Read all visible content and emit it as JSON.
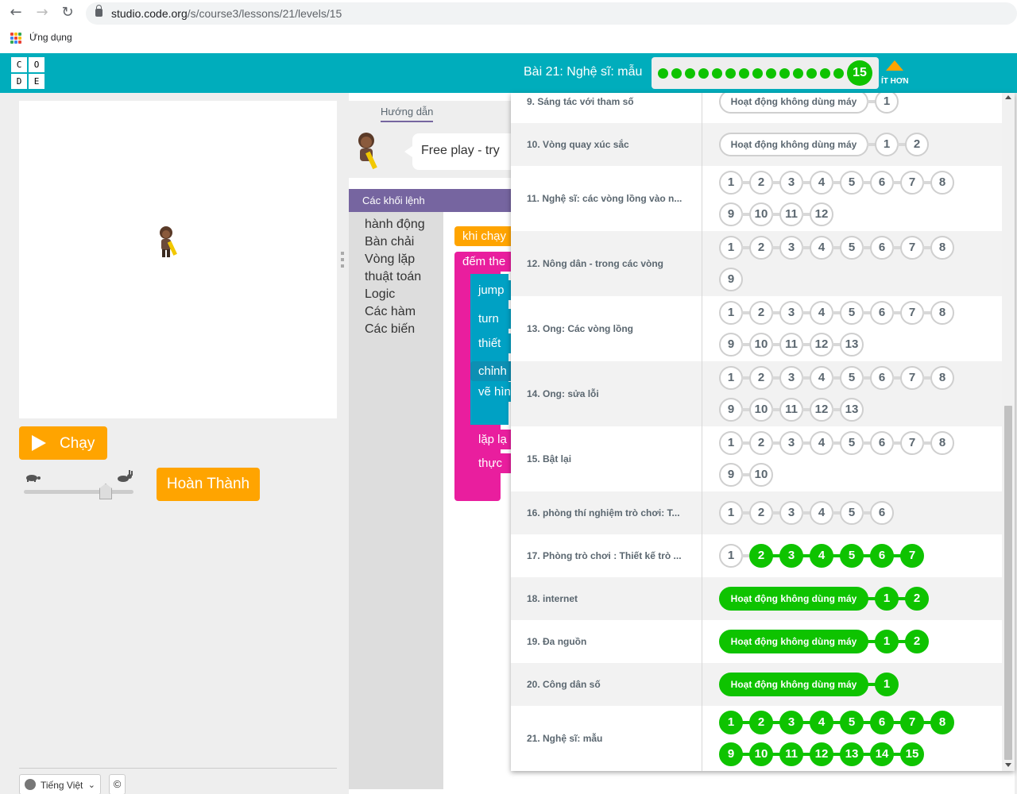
{
  "browser": {
    "url_host": "studio.code.org",
    "url_path": "/s/course3/lessons/21/levels/15",
    "bookmark_apps_label": "Ứng dụng",
    "icons": [
      "back-icon",
      "forward-icon",
      "reload-icon",
      "lock-icon",
      "apps-icon"
    ]
  },
  "header": {
    "logo_letters": [
      "C",
      "O",
      "D",
      "E"
    ],
    "lesson_title": "Bài 21: Nghệ sĩ: mẫu",
    "completed_dots": 14,
    "current_level": "15",
    "less_label": "ÍT HƠN",
    "colors": {
      "header_bg": "#00adbc",
      "done": "#0ec300",
      "accent": "#ffa400"
    }
  },
  "left": {
    "run_label": "Chạy",
    "finish_label": "Hoàn Thành",
    "language": "Tiếng Việt",
    "copyright_symbol": "©"
  },
  "instructions": {
    "tab_label": "Hướng dẫn",
    "text": "Free play - try"
  },
  "toolbox": {
    "title": "Các khối lệnh",
    "categories": [
      "hành động",
      "Bàn chải",
      "Vòng lặp",
      "thuật toán",
      "Logic",
      "Các hàm",
      "Các biến"
    ]
  },
  "workspace": {
    "blocks": [
      "khi chạy",
      "đếm the",
      "jump",
      "turn",
      "thiết",
      "chỉnh",
      "vẽ hìn",
      "lặp lạ",
      "thực"
    ]
  },
  "lessons": [
    {
      "name": "9. Sáng tác với tham số",
      "unplugged": "Hoạt động không dùng máy",
      "levels": [
        "1"
      ],
      "done": [],
      "unplugged_done": false
    },
    {
      "name": "10. Vòng quay xúc sắc",
      "unplugged": "Hoạt động không dùng máy",
      "levels": [
        "1",
        "2"
      ],
      "done": [],
      "unplugged_done": false
    },
    {
      "name": "11. Nghệ sĩ: các vòng lồng vào n...",
      "levels": [
        "1",
        "2",
        "3",
        "4",
        "5",
        "6",
        "7",
        "8",
        "9",
        "10",
        "11",
        "12"
      ],
      "done": []
    },
    {
      "name": "12. Nông dân - trong các vòng",
      "levels": [
        "1",
        "2",
        "3",
        "4",
        "5",
        "6",
        "7",
        "8",
        "9"
      ],
      "done": []
    },
    {
      "name": "13. Ong: Các vòng lồng",
      "levels": [
        "1",
        "2",
        "3",
        "4",
        "5",
        "6",
        "7",
        "8",
        "9",
        "10",
        "11",
        "12",
        "13"
      ],
      "done": []
    },
    {
      "name": "14. Ong: sửa lỗi",
      "levels": [
        "1",
        "2",
        "3",
        "4",
        "5",
        "6",
        "7",
        "8",
        "9",
        "10",
        "11",
        "12",
        "13"
      ],
      "done": []
    },
    {
      "name": "15. Bật lại",
      "levels": [
        "1",
        "2",
        "3",
        "4",
        "5",
        "6",
        "7",
        "8",
        "9",
        "10"
      ],
      "done": []
    },
    {
      "name": "16. phòng thí nghiệm trò chơi: T...",
      "levels": [
        "1",
        "2",
        "3",
        "4",
        "5",
        "6"
      ],
      "done": []
    },
    {
      "name": "17. Phòng trò chơi : Thiết kế trò ...",
      "levels": [
        "1",
        "2",
        "3",
        "4",
        "5",
        "6",
        "7"
      ],
      "done": [
        "2",
        "3",
        "4",
        "5",
        "6",
        "7"
      ]
    },
    {
      "name": "18. internet",
      "unplugged": "Hoạt động không dùng máy",
      "levels": [
        "1",
        "2"
      ],
      "done": [
        "1",
        "2"
      ],
      "unplugged_done": true
    },
    {
      "name": "19. Đa nguồn",
      "unplugged": "Hoạt động không dùng máy",
      "levels": [
        "1",
        "2"
      ],
      "done": [
        "1",
        "2"
      ],
      "unplugged_done": true
    },
    {
      "name": "20. Công dân số",
      "unplugged": "Hoạt động không dùng máy",
      "levels": [
        "1"
      ],
      "done": [
        "1"
      ],
      "unplugged_done": true
    },
    {
      "name": "21. Nghệ sĩ: mẫu",
      "levels": [
        "1",
        "2",
        "3",
        "4",
        "5",
        "6",
        "7",
        "8",
        "9",
        "10",
        "11",
        "12",
        "13",
        "14",
        "15"
      ],
      "done": [
        "1",
        "2",
        "3",
        "4",
        "5",
        "6",
        "7",
        "8",
        "9",
        "10",
        "11",
        "12",
        "13",
        "14",
        "15"
      ]
    }
  ]
}
